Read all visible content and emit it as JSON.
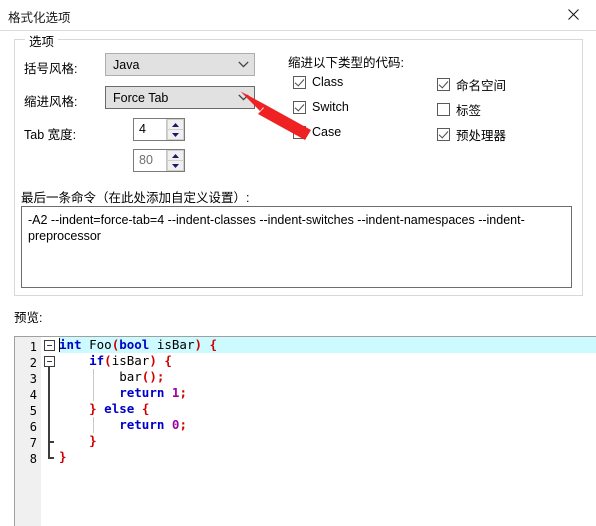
{
  "window": {
    "title": "格式化选项",
    "close_icon": "close-icon"
  },
  "options_group": {
    "legend": "选项",
    "fields": [
      {
        "label": "括号风格:",
        "value": "Java",
        "type": "combo"
      },
      {
        "label": "缩进风格:",
        "value": "Force Tab",
        "type": "combo",
        "focused": true
      },
      {
        "label": "Tab 宽度:",
        "value": "4",
        "type": "spinner"
      },
      {
        "label": "",
        "value": "80",
        "type": "spinner",
        "dim": true
      }
    ],
    "indent_types": {
      "title": "缩进以下类型的代码:",
      "items": [
        {
          "label": "Class",
          "checked": true
        },
        {
          "label": "Switch",
          "checked": true
        },
        {
          "label": "Case",
          "checked": false
        },
        {
          "label": "命名空间",
          "checked": true
        },
        {
          "label": "标签",
          "checked": false
        },
        {
          "label": "预处理器",
          "checked": true
        }
      ]
    },
    "command": {
      "label": "最后一条命令（在此处添加自定义设置）:",
      "value": "-A2 --indent=force-tab=4 --indent-classes --indent-switches --indent-namespaces --indent-preprocessor"
    }
  },
  "preview": {
    "label": "预览:",
    "line_numbers": [
      "1",
      "2",
      "3",
      "4",
      "5",
      "6",
      "7",
      "8"
    ],
    "code_lines": [
      "int Foo(bool isBar) {",
      "    if(isBar) {",
      "        bar();",
      "        return 1;",
      "    } else {",
      "        return 0;",
      "    }",
      "}"
    ]
  },
  "annotation": {
    "arrow_color": "#ee2222",
    "points_to": "缩进风格 下拉箭头"
  },
  "colors": {
    "keyword": "#0000c8",
    "punctuation": "#d00000",
    "number": "#a000a0",
    "current_line": "#ccfaff",
    "accent_red": "#ee2222"
  }
}
